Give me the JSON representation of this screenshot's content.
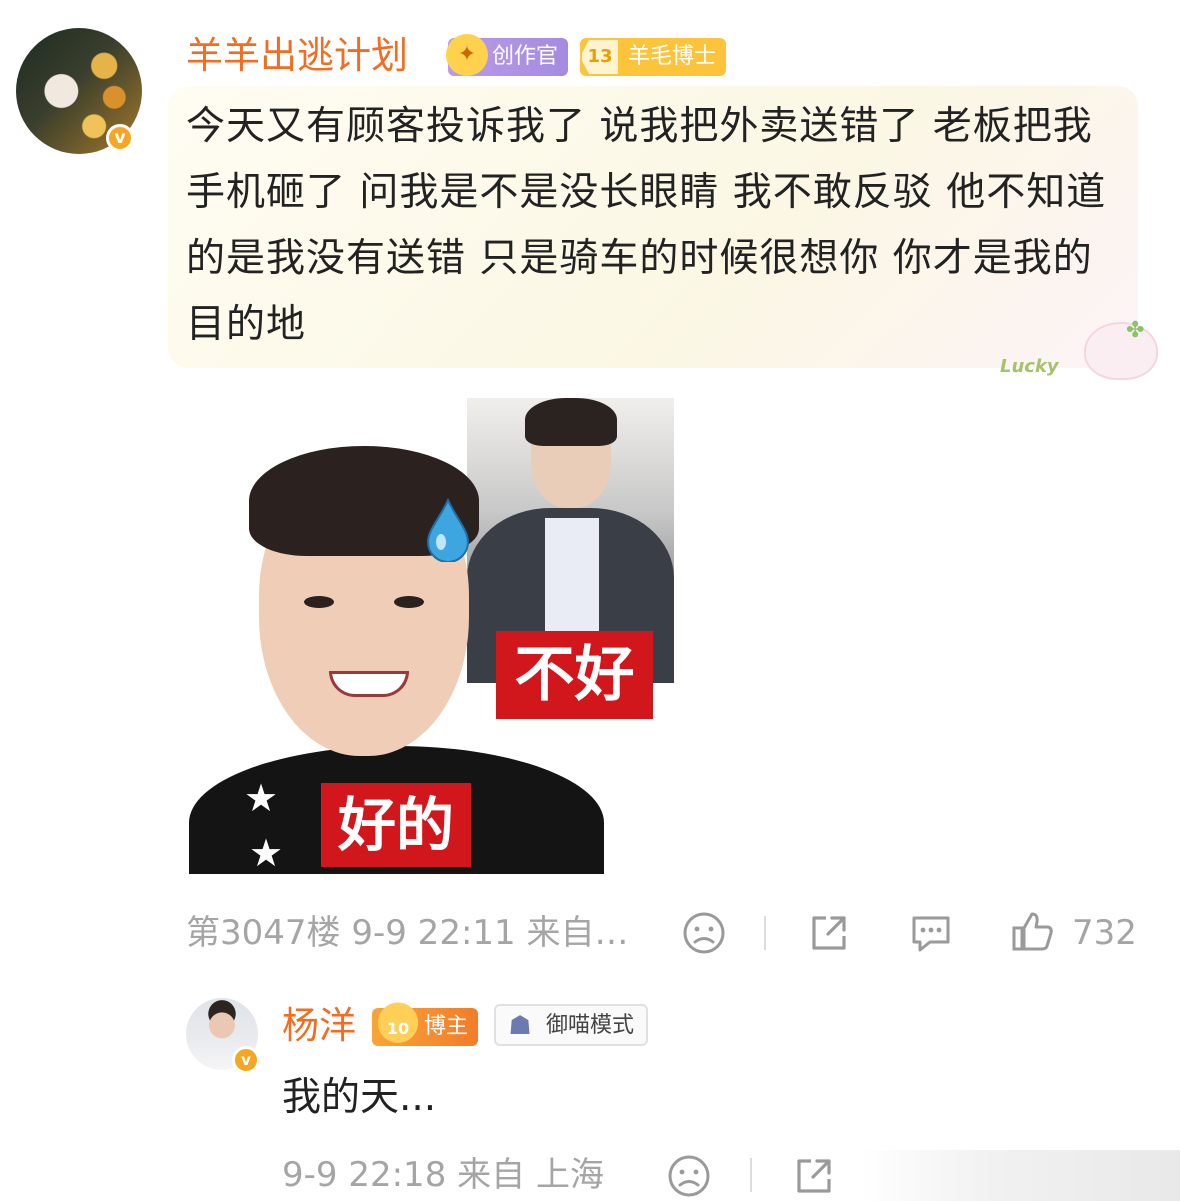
{
  "comment": {
    "username": "羊羊出逃计划",
    "verified_mark": "v",
    "badges": [
      {
        "label": "创作官",
        "icon": "creator-icon",
        "color": "#b99be8"
      },
      {
        "label": "羊毛博士",
        "level": "13",
        "icon": "level-icon",
        "color": "#fbc43a"
      }
    ],
    "text": "今天又有顾客投诉我了 说我把外卖送错了 老板把我手机砸了 问我是不是没长眼睛 我不敢反驳 他不知道的是我没有送错 只是骑车的时候很想你 你才是我的目的地",
    "bubble_decoration": "Lucky",
    "meme": {
      "label_top": "不好",
      "label_bottom": "好的",
      "label_color": "#d1171c"
    },
    "floor": "第3047楼",
    "time": "9-9 22:11",
    "source": "来自…",
    "like_count": "732",
    "actions": [
      "dislike-icon",
      "share-icon",
      "reply-icon",
      "like-icon"
    ]
  },
  "reply": {
    "username": "杨洋",
    "verified_mark": "v",
    "badges": [
      {
        "label": "博主",
        "level": "10",
        "icon": "blogger-icon",
        "color": "#f8a43b"
      },
      {
        "label": "御喵模式",
        "icon": "cat-mode-icon"
      }
    ],
    "text": "我的天...",
    "time": "9-9 22:18",
    "source": "来自 上海",
    "actions": [
      "dislike-icon",
      "share-icon"
    ]
  },
  "colors": {
    "username": "#f26c21",
    "meta": "#a5a5a5",
    "verified": "#f5a623"
  }
}
